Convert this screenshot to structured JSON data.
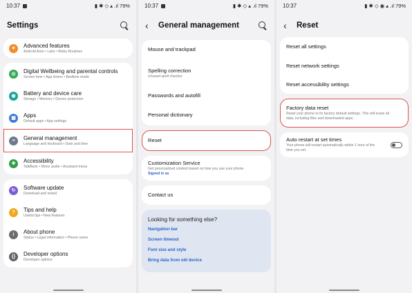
{
  "status": {
    "time": "10:37",
    "battery": "79%"
  },
  "panel1": {
    "title": "Settings",
    "cards": [
      [
        {
          "label": "Advanced features",
          "sub": "Android Auto • Labs • Bixby Routines",
          "icon": "star-icon",
          "color": "#f28c28"
        }
      ],
      [
        {
          "label": "Digital Wellbeing and parental controls",
          "sub": "Screen time • App timers • Bedtime mode",
          "icon": "wellbeing-icon",
          "color": "#34a853"
        },
        {
          "label": "Battery and device care",
          "sub": "Storage • Memory • Device protection",
          "icon": "battery-care-icon",
          "color": "#1aa39a"
        },
        {
          "label": "Apps",
          "sub": "Default apps • App settings",
          "icon": "apps-icon",
          "color": "#3c78d8"
        },
        {
          "label": "General management",
          "sub": "Language and keyboard • Date and time",
          "icon": "general-management-icon",
          "color": "#6d7a8c"
        },
        {
          "label": "Accessibility",
          "sub": "TalkBack • Mono audio • Assistant menu",
          "icon": "accessibility-icon",
          "color": "#2f9e44"
        }
      ],
      [
        {
          "label": "Software update",
          "sub": "Download and install",
          "icon": "software-update-icon",
          "color": "#7b5cd6"
        },
        {
          "label": "Tips and help",
          "sub": "Useful tips • New features",
          "icon": "tips-icon",
          "color": "#f2a81d"
        },
        {
          "label": "About phone",
          "sub": "Status • Legal information • Phone name",
          "icon": "info-icon",
          "color": "#6d6d6d"
        },
        {
          "label": "Developer options",
          "sub": "Developer options",
          "icon": "developer-icon",
          "color": "#5f6368"
        }
      ]
    ]
  },
  "panel2": {
    "title": "General management",
    "items_a": [
      {
        "label": "Mouse and trackpad",
        "sub": ""
      },
      {
        "label": "Spelling correction",
        "sub": "Unused spell checker"
      },
      {
        "label": "Passwords and autofill",
        "sub": ""
      },
      {
        "label": "Personal dictionary",
        "sub": ""
      }
    ],
    "reset": "Reset",
    "customization": {
      "label": "Customization Service",
      "sub": "Get personalized content based on how you use your phone",
      "link": "Signed in as"
    },
    "contact": "Contact us",
    "look": {
      "heading": "Looking for something else?",
      "links": [
        "Navigation bar",
        "Screen timeout",
        "Font size and style",
        "Bring data from old device"
      ]
    }
  },
  "panel3": {
    "title": "Reset",
    "items": [
      "Reset all settings",
      "Reset network settings",
      "Reset accessibility settings"
    ],
    "factory": {
      "label": "Factory data reset",
      "sub1": "Reset your phone to its factory default settings. This will erase all",
      "sub2": "data, including files and downloaded apps."
    },
    "auto": {
      "label": "Auto restart at set times",
      "sub1": "Your phone will restart automatically within 1 hour of the",
      "sub2": "time you set."
    }
  }
}
